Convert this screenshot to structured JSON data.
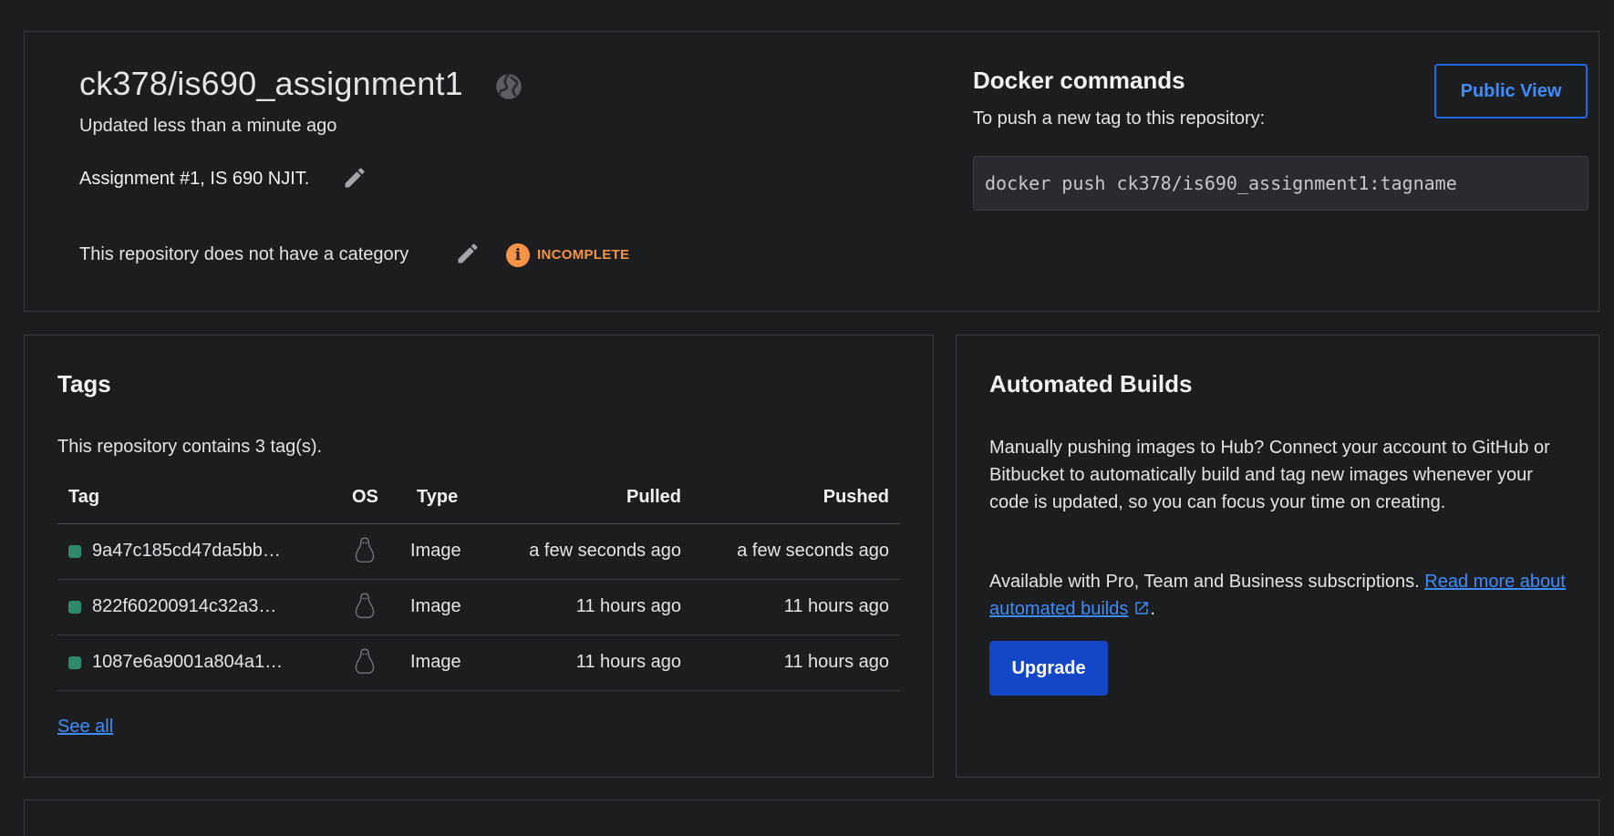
{
  "repo": {
    "title": "ck378/is690_assignment1",
    "updated": "Updated less than a minute ago",
    "description": "Assignment #1, IS 690 NJIT.",
    "category_text": "This repository does not have a category",
    "status_badge": "INCOMPLETE",
    "public_view_label": "Public View"
  },
  "docker_commands": {
    "title": "Docker commands",
    "subtitle": "To push a new tag to this repository:",
    "command": "docker push ck378/is690_assignment1:tagname"
  },
  "tags": {
    "title": "Tags",
    "summary": "This repository contains 3 tag(s).",
    "columns": [
      "Tag",
      "OS",
      "Type",
      "Pulled",
      "Pushed"
    ],
    "rows": [
      {
        "tag": "9a47c185cd47da5bb…",
        "os": "linux-icon",
        "type": "Image",
        "pulled": "a few seconds ago",
        "pushed": "a few seconds ago"
      },
      {
        "tag": "822f60200914c32a3…",
        "os": "linux-icon",
        "type": "Image",
        "pulled": "11 hours ago",
        "pushed": "11 hours ago"
      },
      {
        "tag": "1087e6a9001a804a1…",
        "os": "linux-icon",
        "type": "Image",
        "pulled": "11 hours ago",
        "pushed": "11 hours ago"
      }
    ],
    "see_all_label": "See all"
  },
  "automated_builds": {
    "title": "Automated Builds",
    "paragraph1": "Manually pushing images to Hub? Connect your account to GitHub or Bitbucket to automatically build and tag new images whenever your code is updated, so you can focus your time on creating.",
    "paragraph2_text": "Available with Pro, Team and Business subscriptions. ",
    "paragraph2_link": "Read more about automated builds",
    "paragraph2_end": ".",
    "upgrade_label": "Upgrade"
  },
  "colors": {
    "background": "#1c1d1f",
    "accent_blue": "#3f8cff",
    "button_blue": "#1447c7",
    "warning_orange": "#f59347",
    "tag_status_green": "#2e8a6b"
  }
}
